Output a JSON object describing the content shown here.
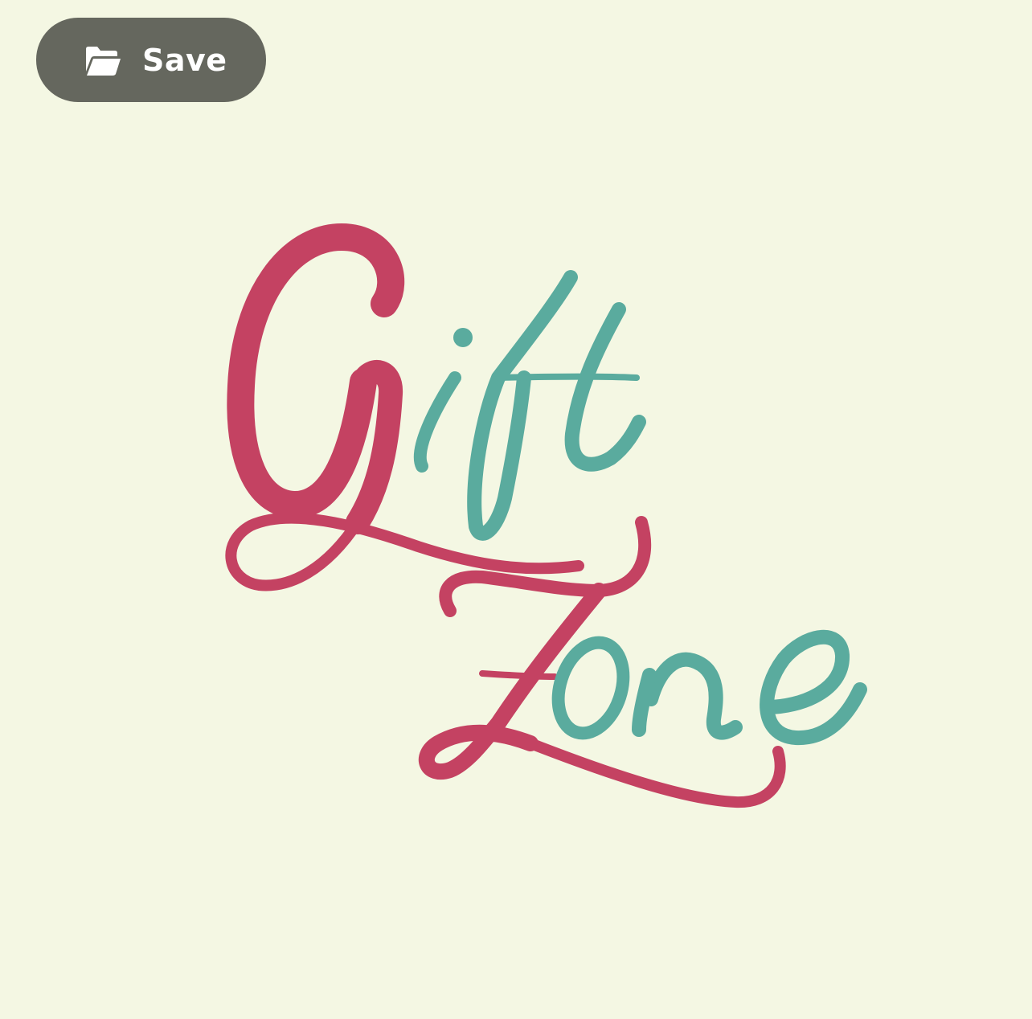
{
  "toolbar": {
    "save_label": "Save",
    "save_icon": "folder-open-icon"
  },
  "logo": {
    "line1": "Gift",
    "line2": "Zone",
    "colors": {
      "crimson": "#c44262",
      "teal": "#5aab9e",
      "background": "#f4f7e3",
      "button": "#65675e"
    }
  }
}
